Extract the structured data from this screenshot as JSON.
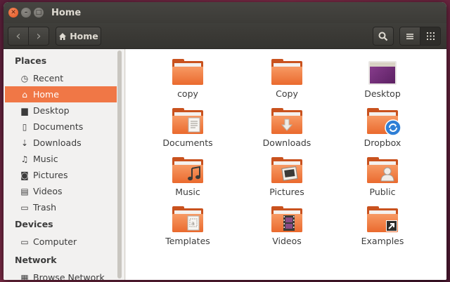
{
  "window": {
    "title": "Home"
  },
  "titlebar": {
    "close_glyph": "✕",
    "minimize_glyph": "–",
    "maximize_glyph": "□"
  },
  "toolbar": {
    "back_glyph": "‹",
    "forward_glyph": "›",
    "path_label": "Home",
    "path_icon": "home-icon",
    "search_icon": "search-icon",
    "list_view_icon": "list-view-icon",
    "grid_view_icon": "grid-view-icon"
  },
  "sidebar": {
    "sections": [
      {
        "header": "Places",
        "items": [
          {
            "label": "Recent",
            "icon": "clock-icon",
            "glyph": "◷"
          },
          {
            "label": "Home",
            "icon": "home-icon",
            "glyph": "⌂",
            "active": true
          },
          {
            "label": "Desktop",
            "icon": "folder-icon",
            "glyph": "▆"
          },
          {
            "label": "Documents",
            "icon": "document-icon",
            "glyph": "▯"
          },
          {
            "label": "Downloads",
            "icon": "download-icon",
            "glyph": "⇣"
          },
          {
            "label": "Music",
            "icon": "music-icon",
            "glyph": "♫"
          },
          {
            "label": "Pictures",
            "icon": "camera-icon",
            "glyph": "◙"
          },
          {
            "label": "Videos",
            "icon": "film-icon",
            "glyph": "▤"
          },
          {
            "label": "Trash",
            "icon": "trash-icon",
            "glyph": "▭"
          }
        ]
      },
      {
        "header": "Devices",
        "items": [
          {
            "label": "Computer",
            "icon": "drive-icon",
            "glyph": "▭"
          }
        ]
      },
      {
        "header": "Network",
        "items": [
          {
            "label": "Browse Network",
            "icon": "network-icon",
            "glyph": "▦"
          }
        ]
      }
    ]
  },
  "files": [
    {
      "label": "copy",
      "type": "folder",
      "emblem": ""
    },
    {
      "label": "Copy",
      "type": "folder",
      "emblem": ""
    },
    {
      "label": "Desktop",
      "type": "desktop",
      "emblem": ""
    },
    {
      "label": "Documents",
      "type": "folder",
      "emblem": "document-emblem-icon"
    },
    {
      "label": "Downloads",
      "type": "folder",
      "emblem": "download-arrow-emblem-icon"
    },
    {
      "label": "Dropbox",
      "type": "folder",
      "emblem": "sync-emblem-icon"
    },
    {
      "label": "Music",
      "type": "folder",
      "emblem": "music-note-emblem-icon"
    },
    {
      "label": "Pictures",
      "type": "folder",
      "emblem": "picture-frame-emblem-icon"
    },
    {
      "label": "Public",
      "type": "folder",
      "emblem": "person-emblem-icon"
    },
    {
      "label": "Templates",
      "type": "folder",
      "emblem": "template-emblem-icon"
    },
    {
      "label": "Videos",
      "type": "folder",
      "emblem": "film-strip-emblem-icon"
    },
    {
      "label": "Examples",
      "type": "folder",
      "emblem": "link-arrow-emblem-icon"
    }
  ],
  "colors": {
    "accent": "#f07746",
    "folder_front": "#ea6a2e",
    "folder_back": "#c9521e",
    "titlebar": "#3c3b37"
  }
}
